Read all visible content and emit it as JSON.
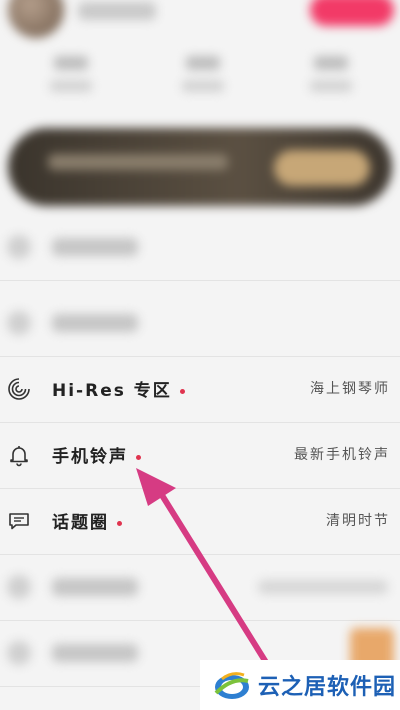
{
  "menu": {
    "items": [
      {
        "label": "Hi-Res 专区",
        "right_text": "海上钢琴师",
        "icon": "hires-icon"
      },
      {
        "label": "手机铃声",
        "right_text": "最新手机铃声",
        "icon": "bell-icon"
      },
      {
        "label": "话题圈",
        "right_text": "清明时节",
        "icon": "chat-icon"
      }
    ]
  },
  "watermark": {
    "text": "云之居软件园"
  },
  "colors": {
    "dot": "#e0344f",
    "arrow": "#d63b83",
    "watermark_text": "#1d60b5",
    "vip_pill": "#f23a67",
    "banner_button": "#c7a777"
  }
}
